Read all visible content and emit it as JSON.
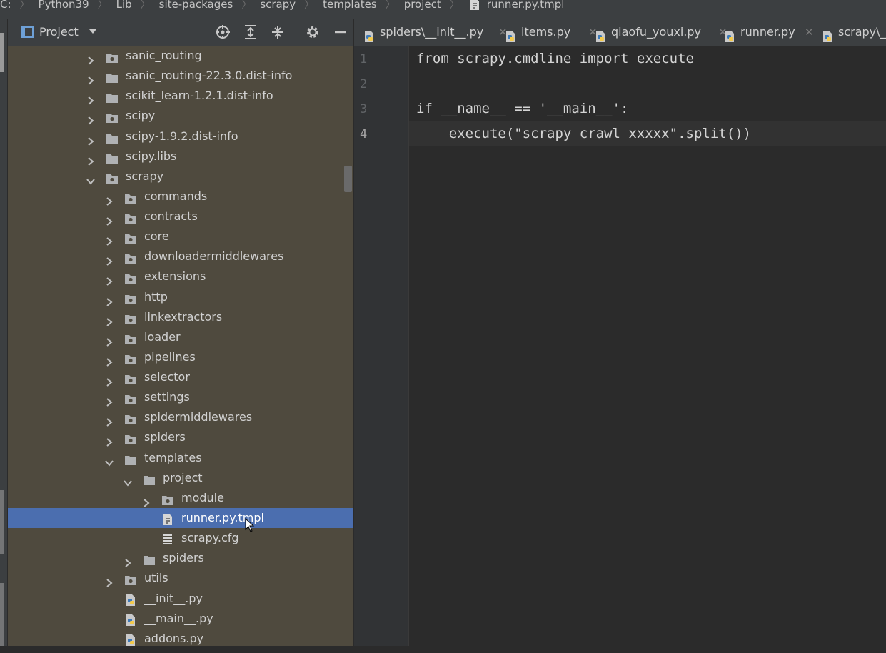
{
  "breadcrumb": {
    "items": [
      "C:",
      "Python39",
      "Lib",
      "site-packages",
      "scrapy",
      "templates",
      "project",
      "runner.py.tmpl"
    ]
  },
  "project_panel": {
    "title": "Project",
    "icons": [
      "locate-icon",
      "expand-all-icon",
      "collapse-all-icon",
      "gear-icon",
      "minimize-icon"
    ]
  },
  "tree": {
    "rows": [
      {
        "label": "sanic_routing",
        "depth": 0,
        "type": "package",
        "expanded": false
      },
      {
        "label": "sanic_routing-22.3.0.dist-info",
        "depth": 0,
        "type": "folder",
        "expanded": false
      },
      {
        "label": "scikit_learn-1.2.1.dist-info",
        "depth": 0,
        "type": "folder",
        "expanded": false
      },
      {
        "label": "scipy",
        "depth": 0,
        "type": "package",
        "expanded": false
      },
      {
        "label": "scipy-1.9.2.dist-info",
        "depth": 0,
        "type": "folder",
        "expanded": false
      },
      {
        "label": "scipy.libs",
        "depth": 0,
        "type": "folder",
        "expanded": false
      },
      {
        "label": "scrapy",
        "depth": 0,
        "type": "package",
        "expanded": true
      },
      {
        "label": "commands",
        "depth": 1,
        "type": "package",
        "expanded": false
      },
      {
        "label": "contracts",
        "depth": 1,
        "type": "package",
        "expanded": false
      },
      {
        "label": "core",
        "depth": 1,
        "type": "package",
        "expanded": false
      },
      {
        "label": "downloadermiddlewares",
        "depth": 1,
        "type": "package",
        "expanded": false
      },
      {
        "label": "extensions",
        "depth": 1,
        "type": "package",
        "expanded": false
      },
      {
        "label": "http",
        "depth": 1,
        "type": "package",
        "expanded": false
      },
      {
        "label": "linkextractors",
        "depth": 1,
        "type": "package",
        "expanded": false
      },
      {
        "label": "loader",
        "depth": 1,
        "type": "package",
        "expanded": false
      },
      {
        "label": "pipelines",
        "depth": 1,
        "type": "package",
        "expanded": false
      },
      {
        "label": "selector",
        "depth": 1,
        "type": "package",
        "expanded": false
      },
      {
        "label": "settings",
        "depth": 1,
        "type": "package",
        "expanded": false
      },
      {
        "label": "spidermiddlewares",
        "depth": 1,
        "type": "package",
        "expanded": false
      },
      {
        "label": "spiders",
        "depth": 1,
        "type": "package",
        "expanded": false
      },
      {
        "label": "templates",
        "depth": 1,
        "type": "folder",
        "expanded": true
      },
      {
        "label": "project",
        "depth": 2,
        "type": "folder",
        "expanded": true
      },
      {
        "label": "module",
        "depth": 3,
        "type": "package",
        "expanded": false
      },
      {
        "label": "runner.py.tmpl",
        "depth": 3,
        "type": "textfile",
        "selected": true
      },
      {
        "label": "scrapy.cfg",
        "depth": 3,
        "type": "cfgfile"
      },
      {
        "label": "spiders",
        "depth": 2,
        "type": "folder",
        "expanded": false
      },
      {
        "label": "utils",
        "depth": 1,
        "type": "package",
        "expanded": false
      },
      {
        "label": "__init__.py",
        "depth": 1,
        "type": "python"
      },
      {
        "label": "__main__.py",
        "depth": 1,
        "type": "python"
      },
      {
        "label": "addons.py",
        "depth": 1,
        "type": "python"
      }
    ]
  },
  "tabs": [
    {
      "label": "spiders\\__init__.py",
      "closable": true
    },
    {
      "label": "items.py",
      "closable": true
    },
    {
      "label": "qiaofu_youxi.py",
      "closable": true
    },
    {
      "label": "runner.py",
      "closable": true
    },
    {
      "label": "scrapy\\__",
      "closable": false
    }
  ],
  "editor": {
    "line_numbers": [
      "1",
      "2",
      "3",
      "4"
    ],
    "current_line": 4,
    "lines": [
      [
        {
          "t": "from",
          "c": "kw"
        },
        {
          "t": " scrapy.cmdline ",
          "c": "id"
        },
        {
          "t": "import",
          "c": "kw"
        },
        {
          "t": " execute",
          "c": "id"
        }
      ],
      [],
      [
        {
          "t": "if",
          "c": "kw"
        },
        {
          "t": " __name__ == ",
          "c": "id"
        },
        {
          "t": "'__main__'",
          "c": "str"
        },
        {
          "t": ":",
          "c": "id"
        }
      ],
      [
        {
          "t": "    execute(",
          "c": "id"
        },
        {
          "t": "\"scrapy crawl xxxxx\"",
          "c": "str"
        },
        {
          "t": ".split())",
          "c": "id"
        }
      ]
    ]
  },
  "colors": {
    "panel_bg": "#4f4a3e",
    "selection": "#4b6eaf",
    "editor_bg": "#2b2b2b",
    "folder_icon": "#afb1b3",
    "python_blue": "#3d7ab8",
    "python_yellow": "#f2c94c"
  }
}
